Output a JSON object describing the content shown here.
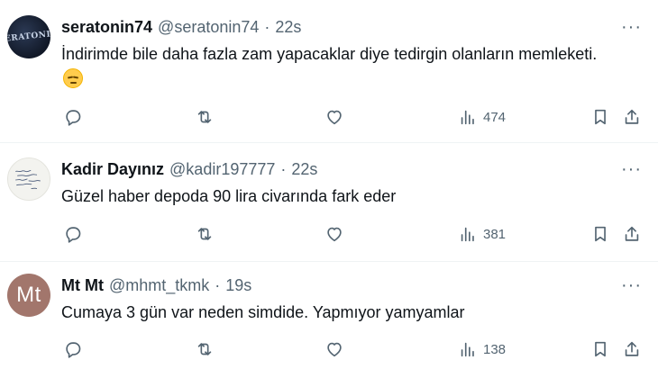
{
  "tweets": [
    {
      "avatar_text": "SERATONIN",
      "name": "seratonin74",
      "handle": "@seratonin74",
      "separator": "·",
      "time": "22s",
      "text": "İndirimde bile daha fazla zam yapacaklar diye tedirgin olanların memleketi.",
      "emoji": "pensive-face",
      "views": "474"
    },
    {
      "avatar_text": "",
      "name": "Kadir Dayınız",
      "handle": "@kadir197777",
      "separator": "·",
      "time": "22s",
      "text": "Güzel haber depoda 90 lira civarında fark eder",
      "views": "381"
    },
    {
      "avatar_text": "Mt",
      "name": "Mt Mt",
      "handle": "@mhmt_tkmk",
      "separator": "·",
      "time": "19s",
      "text": "Cumaya 3 gün var neden simdide. Yapmıyor yamyamlar",
      "views": "138"
    }
  ],
  "more_label": "···",
  "icons": {
    "reply": "reply-icon",
    "retweet": "retweet-icon",
    "like": "heart-icon",
    "views": "views-chart-icon",
    "bookmark": "bookmark-icon",
    "share": "share-icon",
    "more": "more-icon"
  },
  "colors": {
    "text": "#0f1419",
    "secondary": "#536471",
    "divider": "#eff3f4",
    "avatar_mt": "#a2766c"
  }
}
